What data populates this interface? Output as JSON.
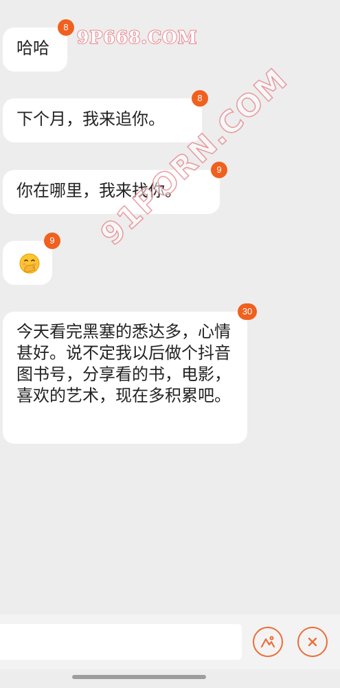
{
  "watermarks": {
    "top": "9P668.COM",
    "diagonal": "91PORN.COM"
  },
  "messages": [
    {
      "text": "哈哈",
      "badge": "8"
    },
    {
      "text": "下个月，我来追你。",
      "badge": "8"
    },
    {
      "text": "你在哪里，我来找你。",
      "badge": "9"
    },
    {
      "text": "",
      "emoji": "face-with-hand-over-mouth",
      "badge": "9"
    },
    {
      "text": "今天看完黑塞的悉达多，心情甚好。说不定我以后做个抖音图书号，分享看的书，电影，喜欢的艺术，现在多积累吧。",
      "badge": "30"
    }
  ],
  "input": {
    "value": "",
    "placeholder": ""
  },
  "icons": {
    "image_button": "image-icon",
    "close_button": "close-icon"
  },
  "colors": {
    "accent": "#f0601f",
    "background": "#ededed",
    "bubble": "#ffffff"
  }
}
